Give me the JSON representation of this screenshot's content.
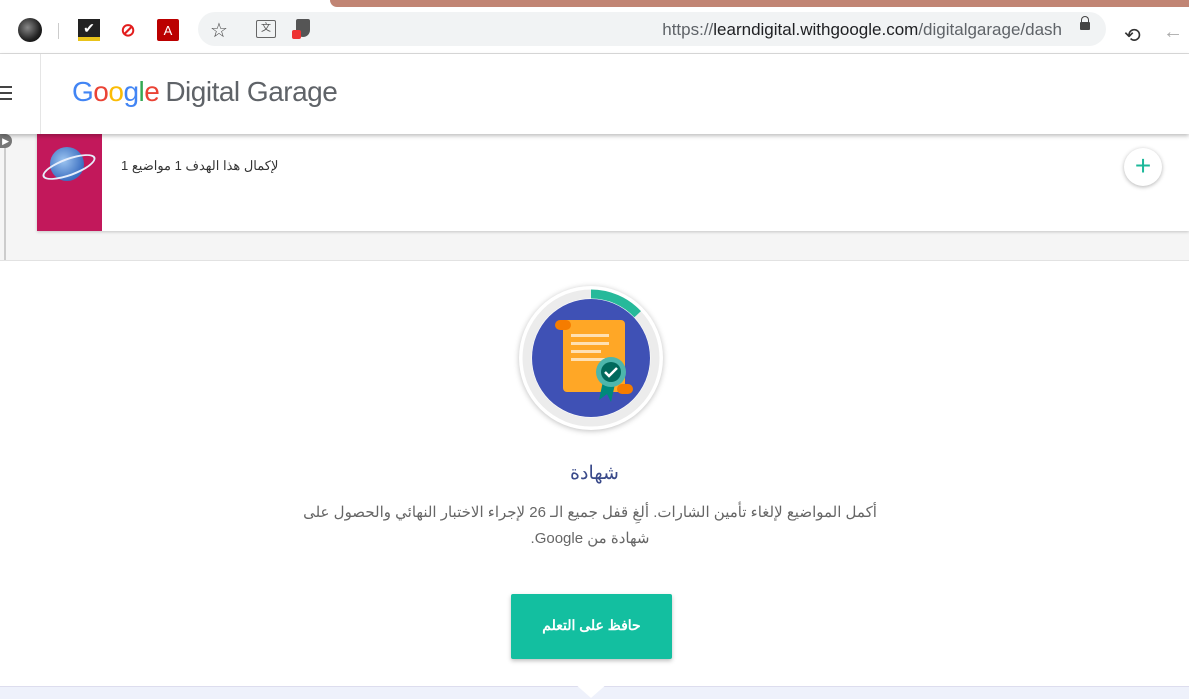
{
  "browser": {
    "url_main": "https://",
    "url_host": "learndigital.withgoogle.com",
    "url_path": "/digitalgarage/dash",
    "icons": [
      "avatar-icon",
      "checkbox-extension-icon",
      "no-flash-extension-icon",
      "pdf-extension-icon",
      "star-icon",
      "translate-icon",
      "shield-extension-icon",
      "lock-icon",
      "reload-icon",
      "back-icon"
    ]
  },
  "header": {
    "logo_google": [
      "G",
      "o",
      "o",
      "g",
      "l",
      "e"
    ],
    "logo_product": "Digital Garage",
    "menu_icon": "hamburger-icon"
  },
  "goal": {
    "text": "لإكمال هذا الهدف 1 مواضيع 1",
    "add_icon": "+"
  },
  "certificate": {
    "title": "شهادة",
    "description": "أكمل المواضيع لإلغاء تأمين الشارات. ألغِ قفل جميع الـ 26 لإجراء الاختبار النهائي والحصول على شهادة من Google.",
    "button_label": "حافظ على التعلم",
    "progress_fraction": 0.13,
    "colors": {
      "accent": "#13bfa0",
      "ring_bg": "#ececec",
      "circle": "#3f51b5",
      "scroll": "#ffa726"
    }
  }
}
